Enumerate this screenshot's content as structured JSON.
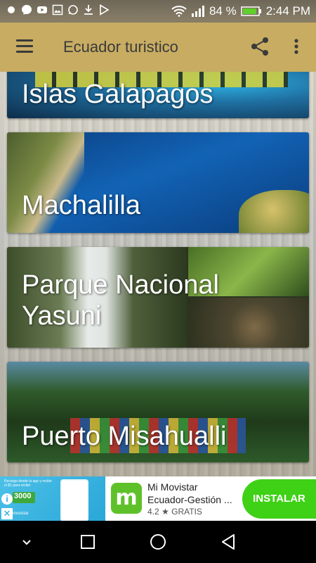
{
  "status_bar": {
    "icons": [
      "dot-icon",
      "messenger-icon",
      "youtube-icon",
      "gallery-icon",
      "whatsapp-icon",
      "download-icon",
      "play-store-icon"
    ],
    "battery_percent": "84 %",
    "time": "2:44 PM"
  },
  "app_bar": {
    "title": "Ecuador turistico",
    "menu_icon": "hamburger-menu-icon",
    "share_icon": "share-icon",
    "more_icon": "more-vert-icon"
  },
  "destinations": [
    {
      "label": "Islas Galapagos"
    },
    {
      "label": "Machalilla"
    },
    {
      "label": "Parque Nacional\nYasuni"
    },
    {
      "label": "Puerto Misahualli"
    }
  ],
  "ad": {
    "thumb_text": "Recarga desde la app y recibe el $1 para recibir",
    "thumb_badge": "3000",
    "thumb_brand": "movistar",
    "logo_letter": "m",
    "title": "Mi Movistar",
    "subtitle": "Ecuador-Gestión ...",
    "rating": "4.2 ★ GRATIS",
    "install_label": "INSTALAR"
  },
  "colors": {
    "app_bar": "#c8ac62",
    "install": "#3fd116",
    "ad_logo": "#5fc12a"
  }
}
